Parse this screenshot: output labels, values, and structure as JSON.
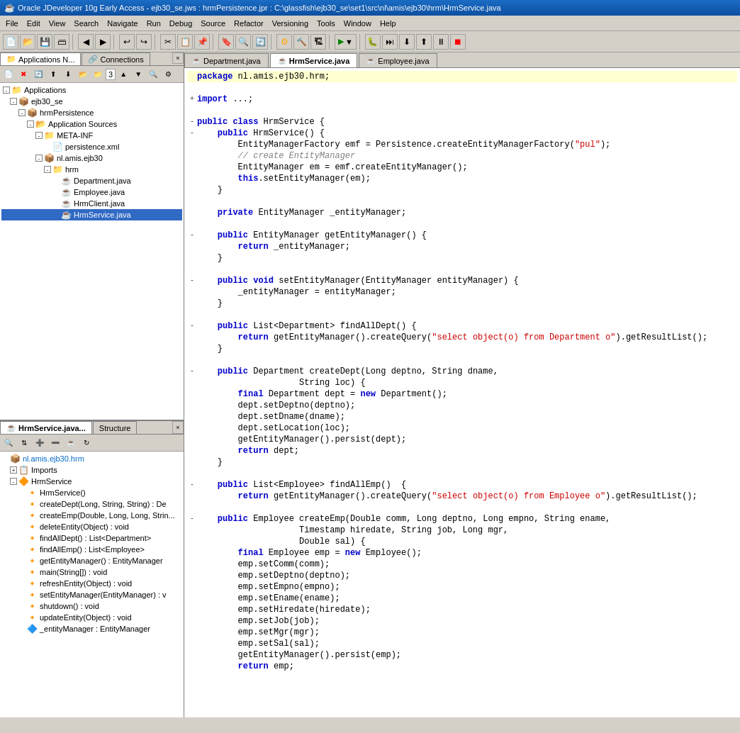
{
  "titlebar": {
    "text": "Oracle JDeveloper 10g Early Access - ejb30_se.jws : hrmPersistence.jpr : C:\\glassfish\\ejb30_se\\set1\\src\\nl\\amis\\ejb30\\hrm\\HrmService.java"
  },
  "menubar": {
    "items": [
      "File",
      "Edit",
      "View",
      "Search",
      "Navigate",
      "Run",
      "Debug",
      "Source",
      "Refactor",
      "Versioning",
      "Tools",
      "Window",
      "Help"
    ]
  },
  "project_panel": {
    "tabs": [
      {
        "label": "Applications N...",
        "active": true
      },
      {
        "label": "Connections",
        "active": false
      }
    ],
    "close_label": "×"
  },
  "editor_tabs": [
    {
      "label": "Department.java",
      "active": false
    },
    {
      "label": "HrmService.java",
      "active": true
    },
    {
      "label": "Employee.java",
      "active": false
    }
  ],
  "tree": {
    "applications_label": "Applications",
    "ejb30_label": "ejb30_se",
    "hrmPersistence_label": "hrmPersistence",
    "app_sources_label": "Application Sources",
    "meta_inf_label": "META-INF",
    "persistence_xml_label": "persistence.xml",
    "nl_amis_label": "nl.amis.ejb30",
    "hrm_label": "hrm",
    "files": [
      "Department.java",
      "Employee.java",
      "HrmClient.java",
      "HrmService.java"
    ]
  },
  "bottom_panel": {
    "tabs": [
      {
        "label": "HrmService.java...",
        "active": true
      },
      {
        "label": "Structure",
        "active": false
      }
    ],
    "tree_items": [
      {
        "label": "nl.amis.ejb30.hrm",
        "indent": 0,
        "icon": "package"
      },
      {
        "label": "Imports",
        "indent": 1,
        "icon": "folder",
        "expandable": true
      },
      {
        "label": "HrmService",
        "indent": 1,
        "icon": "class",
        "expandable": true
      },
      {
        "label": "HrmService()",
        "indent": 2,
        "icon": "method"
      },
      {
        "label": "createDept(Long, String, String) : De",
        "indent": 2,
        "icon": "method"
      },
      {
        "label": "createEmp(Double, Long, Long, Strin...",
        "indent": 2,
        "icon": "method"
      },
      {
        "label": "deleteEntity(Object) : void",
        "indent": 2,
        "icon": "method"
      },
      {
        "label": "findAllDept() : List<Department>",
        "indent": 2,
        "icon": "method"
      },
      {
        "label": "findAllEmp() : List<Employee>",
        "indent": 2,
        "icon": "method"
      },
      {
        "label": "getEntityManager() : EntityManager",
        "indent": 2,
        "icon": "method"
      },
      {
        "label": "main(String[]) : void",
        "indent": 2,
        "icon": "method"
      },
      {
        "label": "refreshEntity(Object) : void",
        "indent": 2,
        "icon": "method"
      },
      {
        "label": "setEntityManager(EntityManager) : v",
        "indent": 2,
        "icon": "method"
      },
      {
        "label": "shutdown() : void",
        "indent": 2,
        "icon": "method"
      },
      {
        "label": "updateEntity(Object) : void",
        "indent": 2,
        "icon": "method"
      },
      {
        "label": "_entityManager : EntityManager",
        "indent": 2,
        "icon": "field"
      }
    ]
  },
  "code": {
    "package_line": "package nl.amis.ejb30.hrm;",
    "import_line": "import ...;",
    "class_line": "public class HrmService {",
    "constructor_line": "    public HrmService() {",
    "emf_line": "        EntityManagerFactory emf = Persistence.createEntityManagerFactory(\"pul\");",
    "comment_line": "        // create EntityManager",
    "em_line": "        EntityManager em = emf.createEntityManager();",
    "set_line": "        this.setEntityManager(em);",
    "close_brace": "    }",
    "private_em": "    private EntityManager _entityManager;",
    "get_em_sig": "    public EntityManager getEntityManager() {",
    "return_em": "        return _entityManager;",
    "set_em_sig": "    public void setEntityManager(EntityManager entityManager) {",
    "set_em_body": "        _entityManager = entityManager;",
    "find_dept_sig": "    public List<Department> findAllDept() {",
    "find_dept_body": "        return getEntityManager().createQuery(\"select object(o) from Department o\").getResultList();",
    "create_dept_sig": "    public Department createDept(Long deptno, String dname,",
    "create_dept_sig2": "                    String loc) {",
    "new_dept": "        final Department dept = new Department();",
    "dept_setno": "        dept.setDeptno(deptno);",
    "dept_setname": "        dept.setDname(dname);",
    "dept_setloc": "        dept.setLocation(loc);",
    "dept_persist": "        getEntityManager().persist(dept);",
    "return_dept": "        return dept;",
    "find_emp_sig": "    public List<Employee> findAllEmp()  {",
    "find_emp_body": "        return getEntityManager().createQuery(\"select object(o) from Employee o\").getResultList();",
    "create_emp_sig": "    public Employee createEmp(Double comm, Long deptno, Long empno, String ename,",
    "create_emp_sig2": "                    Timestamp hiredate, String job, Long mgr,",
    "create_emp_sig3": "                    Double sal) {",
    "new_emp": "        final Employee emp = new Employee();",
    "emp_comm": "        emp.setComm(comm);",
    "emp_deptno": "        emp.setDeptno(deptno);",
    "emp_empno": "        emp.setEmpno(empno);",
    "emp_ename": "        emp.setEname(ename);",
    "emp_hiredate": "        emp.setHiredate(hiredate);",
    "emp_job": "        emp.setJob(job);",
    "emp_mgr": "        emp.setMgr(mgr);",
    "emp_sal": "        emp.setSal(sal);",
    "emp_persist": "        getEntityManager().persist(emp);",
    "return_emp": "        return emp;"
  },
  "toolbar": {
    "num_input": "3"
  }
}
